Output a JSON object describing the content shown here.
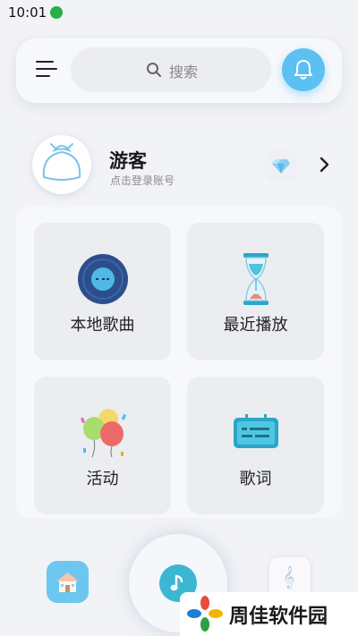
{
  "status_bar": {
    "time": "10:01"
  },
  "search": {
    "placeholder": "搜索"
  },
  "profile": {
    "name": "游客",
    "subtitle": "点击登录账号"
  },
  "tiles": [
    {
      "label": "本地歌曲",
      "icon": "vinyl-record-icon"
    },
    {
      "label": "最近播放",
      "icon": "hourglass-icon"
    },
    {
      "label": "活动",
      "icon": "balloons-icon"
    },
    {
      "label": "歌词",
      "icon": "lyrics-card-icon"
    }
  ],
  "bottom_nav": {
    "items": [
      "home-icon",
      "music-note-icon",
      "treble-clef-icon"
    ],
    "clef_glyph": "𝄞"
  },
  "watermark": {
    "text": "周佳软件园"
  },
  "colors": {
    "accent": "#5cc0f2",
    "teal": "#3bb7d3",
    "background": "#f2f3f7"
  }
}
